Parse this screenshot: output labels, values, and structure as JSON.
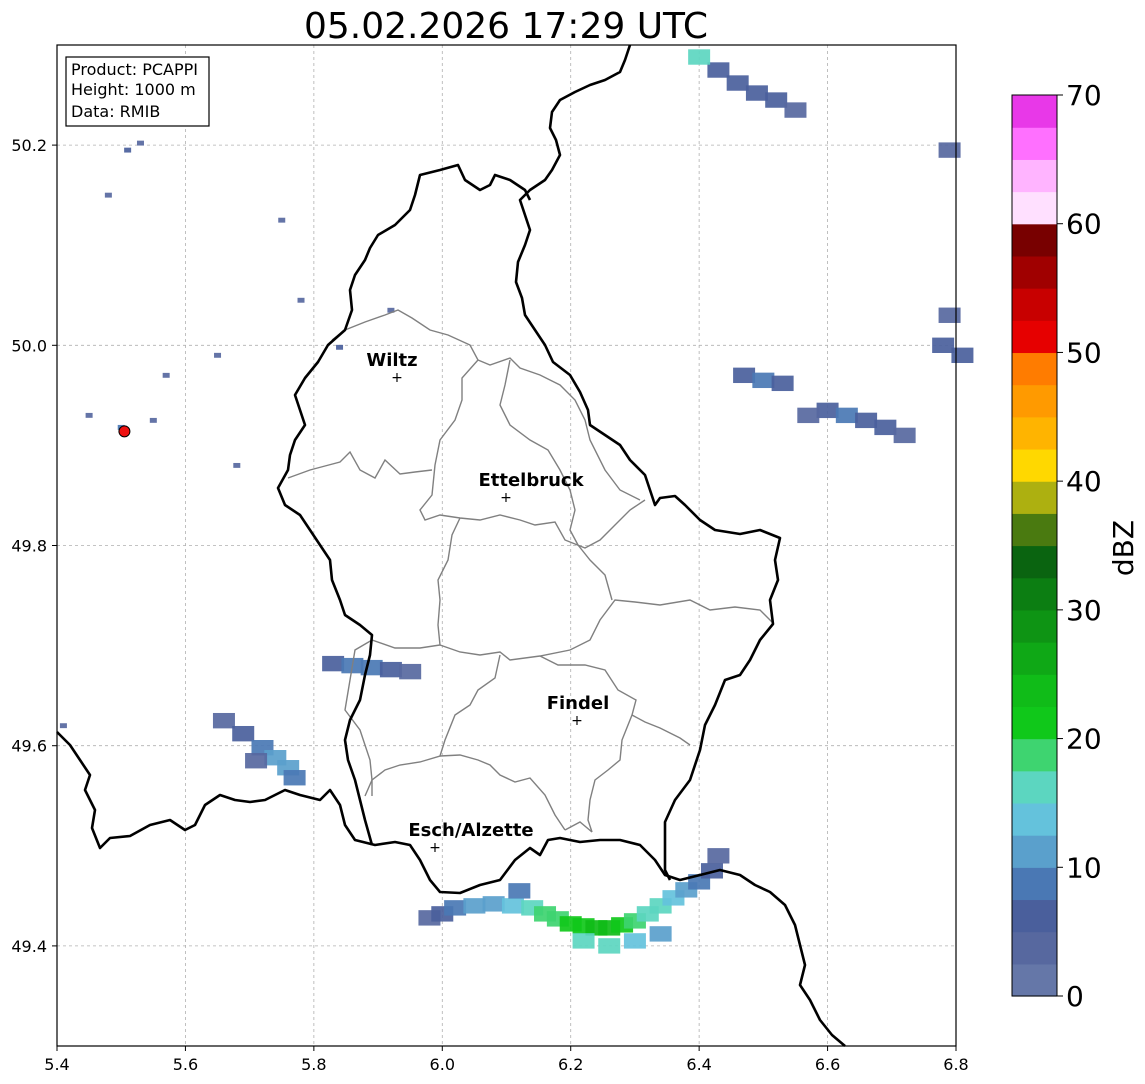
{
  "map": {
    "title": "05.02.2026 17:29 UTC",
    "info_box": {
      "lines": [
        "Product: PCAPPI",
        "Height: 1000 m",
        "Data: RMIB"
      ]
    },
    "x_ticks": [
      "5.4",
      "5.6",
      "5.8",
      "6.0",
      "6.2",
      "6.4",
      "6.6",
      "6.8"
    ],
    "y_ticks": [
      "49.4",
      "49.6",
      "49.8",
      "50.0",
      "50.2"
    ],
    "lon_range": [
      5.4,
      6.8
    ],
    "lat_range": [
      49.3,
      50.3
    ],
    "cities": [
      {
        "name": "Wiltz",
        "lon": 5.935,
        "lat": 49.968
      },
      {
        "name": "Ettelbruck",
        "lon": 6.1,
        "lat": 49.85
      },
      {
        "name": "Findel",
        "lon": 6.21,
        "lat": 49.627
      },
      {
        "name": "Esch/Alzette",
        "lon": 5.99,
        "lat": 49.5
      }
    ],
    "radar_site": {
      "lon": 5.505,
      "lat": 49.914
    },
    "grid": true
  },
  "colorbar": {
    "label": "dBZ",
    "tick_labels": [
      "0",
      "10",
      "20",
      "30",
      "40",
      "50",
      "60",
      "70"
    ],
    "min": 0,
    "max": 70,
    "step": 2.5,
    "colors": [
      "#6577a8",
      "#57689f",
      "#4a5f9c",
      "#4a78b4",
      "#5aa0cc",
      "#64c2dc",
      "#5cd6c0",
      "#3ed470",
      "#10c81a",
      "#10bc18",
      "#0fa816",
      "#0e9414",
      "#0c7e12",
      "#0a6410",
      "#4a7a10",
      "#adb010",
      "#ffd800",
      "#ffb400",
      "#ff9a00",
      "#ff7c00",
      "#e60000",
      "#c80000",
      "#a00000",
      "#780000",
      "#ffe0ff",
      "#ffb4ff",
      "#ff70ff",
      "#e838e8"
    ]
  },
  "echoes": [
    {
      "name": "south-border-band",
      "cells": [
        [
          5.98,
          49.428,
          1
        ],
        [
          6.0,
          49.432,
          2
        ],
        [
          6.02,
          49.438,
          3
        ],
        [
          6.05,
          49.44,
          4
        ],
        [
          6.08,
          49.442,
          4
        ],
        [
          6.11,
          49.44,
          5
        ],
        [
          6.14,
          49.438,
          6
        ],
        [
          6.16,
          49.432,
          7
        ],
        [
          6.18,
          49.427,
          7
        ],
        [
          6.2,
          49.422,
          8
        ],
        [
          6.22,
          49.42,
          8
        ],
        [
          6.24,
          49.418,
          9
        ],
        [
          6.26,
          49.418,
          9
        ],
        [
          6.28,
          49.421,
          8
        ],
        [
          6.3,
          49.425,
          7
        ],
        [
          6.32,
          49.432,
          6
        ],
        [
          6.34,
          49.44,
          6
        ],
        [
          6.36,
          49.448,
          5
        ],
        [
          6.38,
          49.456,
          4
        ],
        [
          6.4,
          49.464,
          3
        ],
        [
          6.42,
          49.475,
          2
        ],
        [
          6.43,
          49.49,
          1
        ],
        [
          6.12,
          49.455,
          3
        ],
        [
          6.3,
          49.405,
          5
        ],
        [
          6.26,
          49.4,
          6
        ],
        [
          6.22,
          49.405,
          6
        ],
        [
          6.34,
          49.412,
          4
        ]
      ]
    },
    {
      "name": "south-west-patch",
      "cells": [
        [
          5.66,
          49.625,
          1
        ],
        [
          5.69,
          49.612,
          2
        ],
        [
          5.72,
          49.598,
          3
        ],
        [
          5.74,
          49.588,
          4
        ],
        [
          5.76,
          49.578,
          4
        ],
        [
          5.77,
          49.568,
          3
        ],
        [
          5.71,
          49.585,
          1
        ]
      ]
    },
    {
      "name": "west-central-band",
      "cells": [
        [
          5.83,
          49.682,
          2
        ],
        [
          5.86,
          49.68,
          3
        ],
        [
          5.89,
          49.678,
          3
        ],
        [
          5.92,
          49.676,
          2
        ],
        [
          5.95,
          49.674,
          1
        ]
      ]
    },
    {
      "name": "east-cluster",
      "cells": [
        [
          6.47,
          49.97,
          2
        ],
        [
          6.5,
          49.965,
          3
        ],
        [
          6.53,
          49.962,
          2
        ],
        [
          6.6,
          49.935,
          2
        ],
        [
          6.63,
          49.93,
          3
        ],
        [
          6.66,
          49.925,
          2
        ],
        [
          6.69,
          49.918,
          2
        ],
        [
          6.72,
          49.91,
          1
        ],
        [
          6.57,
          49.93,
          1
        ],
        [
          6.78,
          50.0,
          2
        ],
        [
          6.81,
          49.99,
          2
        ],
        [
          6.79,
          50.03,
          1
        ]
      ]
    },
    {
      "name": "north-cluster",
      "cells": [
        [
          6.43,
          50.275,
          2
        ],
        [
          6.46,
          50.262,
          2
        ],
        [
          6.49,
          50.252,
          2
        ],
        [
          6.52,
          50.245,
          2
        ],
        [
          6.55,
          50.235,
          1
        ],
        [
          6.4,
          50.288,
          6
        ],
        [
          6.79,
          50.195,
          1
        ]
      ]
    },
    {
      "name": "west-speckles",
      "cells": [
        [
          5.51,
          50.195,
          2
        ],
        [
          5.53,
          50.202,
          1
        ],
        [
          5.48,
          50.15,
          1
        ],
        [
          5.68,
          49.88,
          1
        ],
        [
          5.78,
          50.045,
          1
        ],
        [
          5.75,
          50.125,
          1
        ],
        [
          5.84,
          49.998,
          2
        ],
        [
          5.92,
          50.035,
          1
        ],
        [
          5.57,
          49.97,
          1
        ],
        [
          5.65,
          49.99,
          1
        ],
        [
          5.5,
          49.918,
          3
        ],
        [
          5.45,
          49.93,
          1
        ],
        [
          5.55,
          49.925,
          1
        ],
        [
          5.41,
          49.62,
          1
        ]
      ]
    }
  ]
}
